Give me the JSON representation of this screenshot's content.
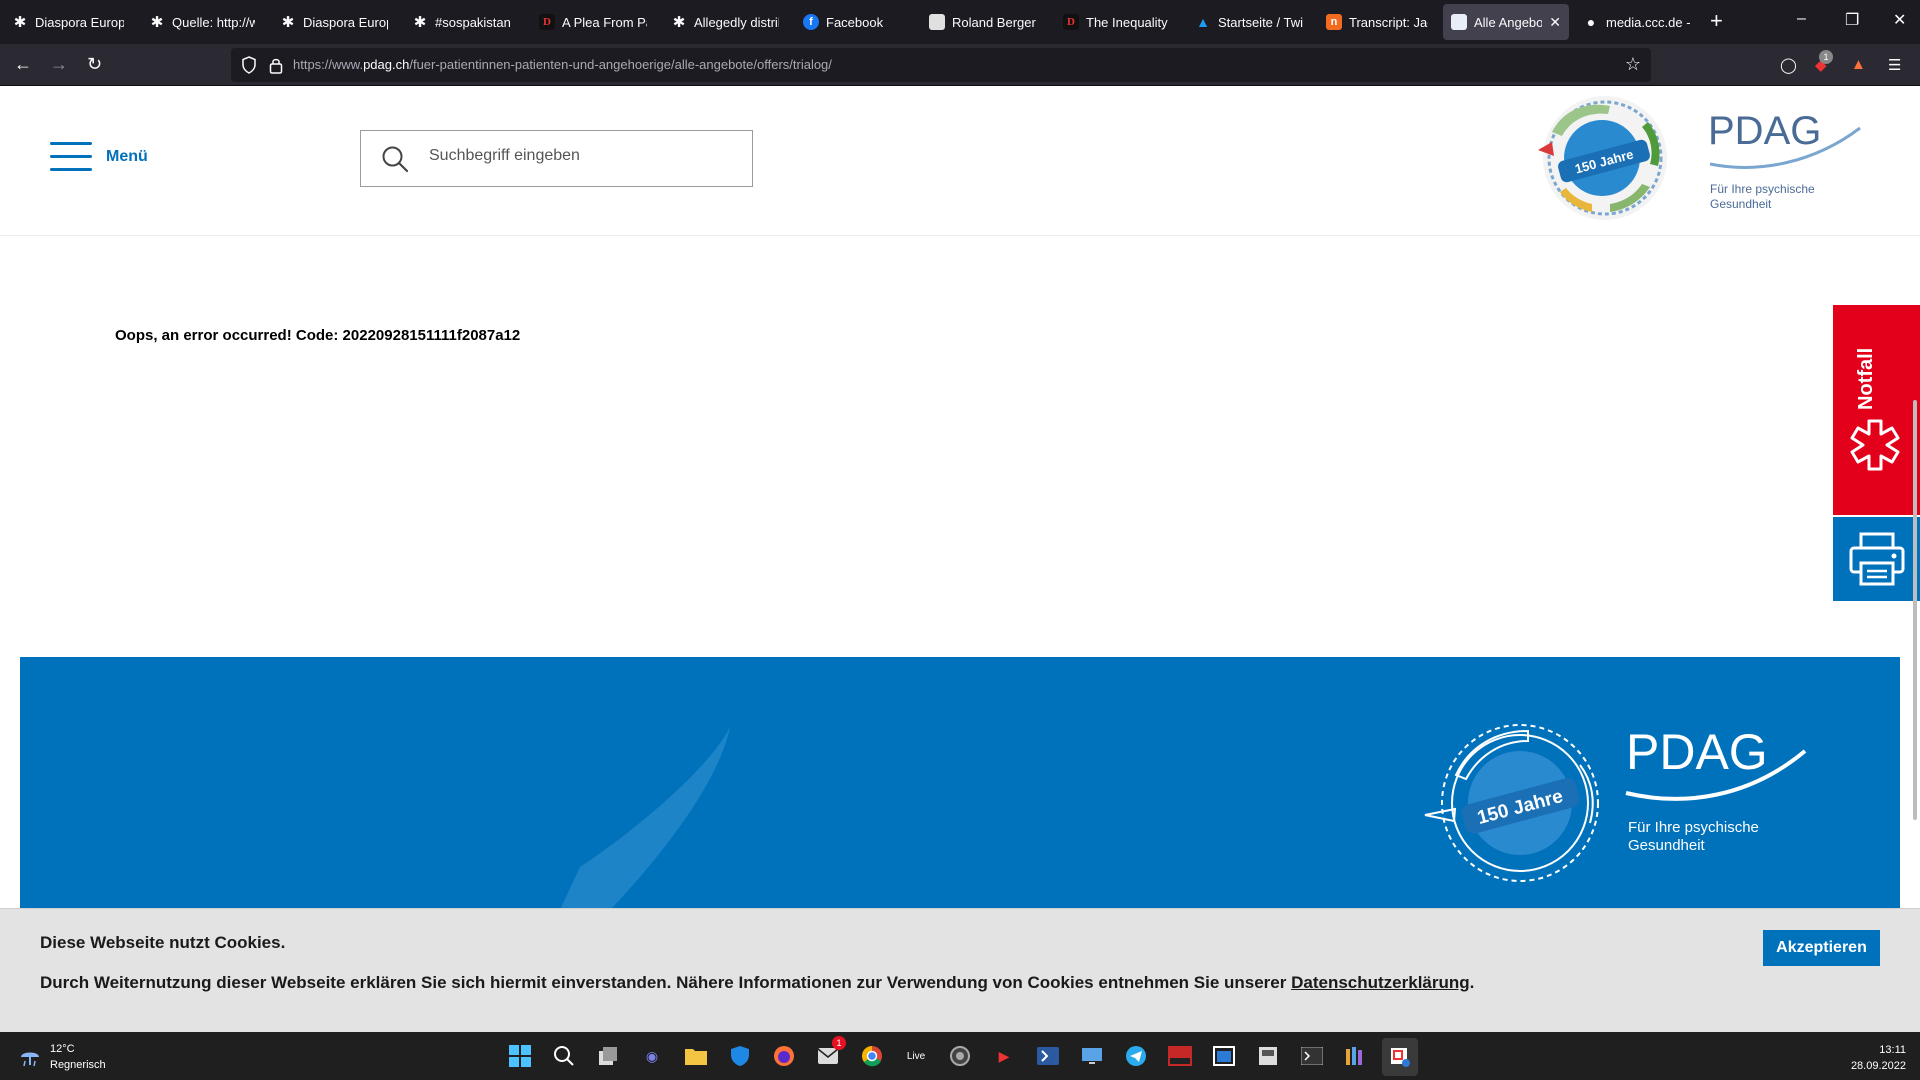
{
  "browser": {
    "tabs": [
      {
        "label": "Diaspora Europe",
        "icon": "diaspora-asterisk-icon"
      },
      {
        "label": "Quelle: http://w",
        "icon": "diaspora-asterisk-icon"
      },
      {
        "label": "Diaspora Europe",
        "icon": "diaspora-asterisk-icon"
      },
      {
        "label": "#sospakistan",
        "icon": "diaspora-asterisk-icon"
      },
      {
        "label": "A Plea From Pak",
        "icon": "d-letter-icon"
      },
      {
        "label": "Allegedly distrib",
        "icon": "diaspora-asterisk-icon"
      },
      {
        "label": "Facebook",
        "icon": "facebook-icon"
      },
      {
        "label": "Roland Berger St",
        "icon": "page-icon"
      },
      {
        "label": "The Inequality P",
        "icon": "d-letter-icon"
      },
      {
        "label": "Startseite / Twitt",
        "icon": "twitter-icon"
      },
      {
        "label": "Transcript: Jacob",
        "icon": "transcript-icon"
      },
      {
        "label": "Alle Angebote",
        "icon": "pdag-favicon",
        "active": true
      },
      {
        "label": "media.ccc.de - T",
        "icon": "github-icon"
      }
    ],
    "new_tab": "+",
    "url_gray_prefix": "https://www.",
    "url_domain": "pdag.ch",
    "url_path": "/fuer-patientinnen-patienten-und-angehoerige/alle-angebote/offers/trialog/",
    "extension_badge": "1"
  },
  "header": {
    "menu_label": "Menü",
    "search_placeholder": "Suchbegriff eingeben",
    "logo": {
      "anniversary": "150 Jahre",
      "name": "PDAG",
      "tagline_1": "Für Ihre psychische",
      "tagline_2": "Gesundheit"
    }
  },
  "main": {
    "error_message": "Oops, an error occurred! Code: 20220928151111f2087a12"
  },
  "side_buttons": {
    "emergency_label": "Notfall",
    "emergency_color": "#e2001a",
    "print_color": "#0072bc"
  },
  "footer": {
    "logo": {
      "anniversary": "150 Jahre",
      "name": "PDAG",
      "tagline_1": "Für Ihre psychische",
      "tagline_2": "Gesundheit"
    },
    "color": "#0072bc"
  },
  "cookie_banner": {
    "title": "Diese Webseite nutzt Cookies.",
    "text": "Durch Weiternutzung dieser Webseite erklären Sie sich hiermit einverstanden. Nähere Informationen zur Verwendung von Cookies entnehmen Sie unserer ",
    "link_text": "Datenschutzerklärung",
    "text_end": ".",
    "accept_label": "Akzeptieren"
  },
  "taskbar": {
    "weather_temp": "12°C",
    "weather_desc": "Regnerisch",
    "time": "13:11",
    "date": "28.09.2022",
    "mail_badge": "1",
    "live_label": "Live"
  },
  "colors": {
    "brand_blue": "#0072bc",
    "brand_red": "#e2001a"
  }
}
